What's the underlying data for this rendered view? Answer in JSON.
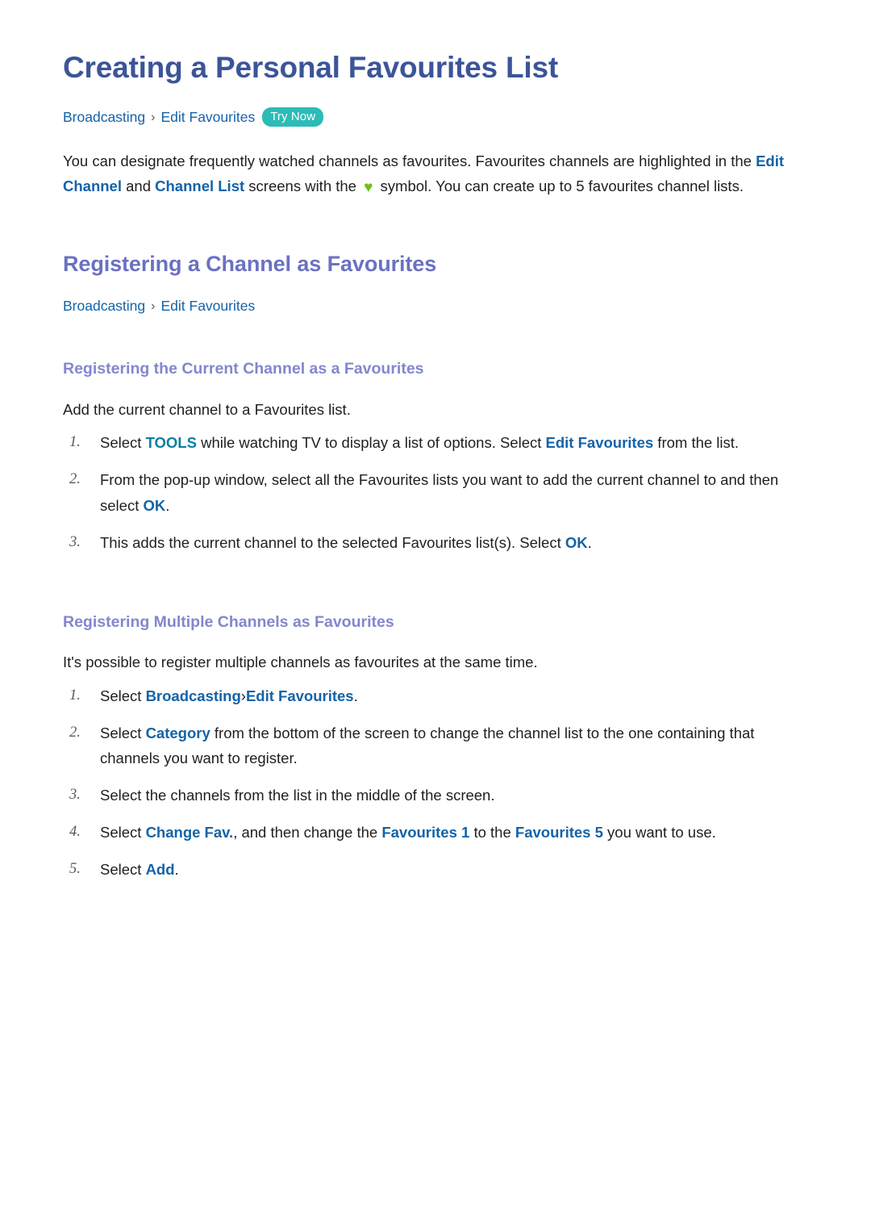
{
  "document": {
    "title": "Creating a Personal Favourites List"
  },
  "breadcrumb_top": {
    "crumb1": "Broadcasting",
    "separator": "›",
    "crumb2": "Edit Favourites",
    "badge": "Try Now"
  },
  "intro": {
    "line1_a": "You can designate frequently watched channels as favourites. Favourites channels are highlighted in the ",
    "link_edit_channel": "Edit Channel",
    "line1_b": " and ",
    "link_channel_list": "Channel List",
    "line1_c": " screens with the ",
    "heart_icon": "♥",
    "line1_d": " symbol. You can create up to 5 favourites channel lists."
  },
  "section_registering": {
    "title": "Registering a Channel as Favourites",
    "breadcrumb": {
      "crumb1": "Broadcasting",
      "separator": "›",
      "crumb2": "Edit Favourites"
    }
  },
  "subsection_current": {
    "title": "Registering the Current Channel as a Favourites",
    "intro": "Add the current channel to a Favourites list.",
    "steps": [
      {
        "a": "Select ",
        "link1": "TOOLS",
        "b": " while watching TV to display a list of options. Select ",
        "link2": "Edit Favourites",
        "c": " from the list."
      },
      {
        "a": "From the pop-up window, select all the Favourites lists you want to add the current channel to and then select ",
        "link1": "OK",
        "b": "."
      },
      {
        "a": "This adds the current channel to the selected Favourites list(s). Select ",
        "link1": "OK",
        "b": "."
      }
    ]
  },
  "subsection_multiple": {
    "title": "Registering Multiple Channels as Favourites",
    "intro": "It's possible to register multiple channels as favourites at the same time.",
    "steps": [
      {
        "a": "Select ",
        "link1": "Broadcasting",
        "sep": "›",
        "link2": "Edit Favourites",
        "b": "."
      },
      {
        "a": "Select ",
        "link1": "Category",
        "b": " from the bottom of the screen to change the channel list to the one containing that channels you want to register."
      },
      {
        "a": "Select the channels from the list in the middle of the screen."
      },
      {
        "a": "Select ",
        "link1": "Change Fav.",
        "b": ", and then change the ",
        "link2": "Favourites 1",
        "c": " to the ",
        "link3": "Favourites 5",
        "d": " you want to use."
      },
      {
        "a": "Select ",
        "link1": "Add",
        "b": "."
      }
    ]
  },
  "colors": {
    "h1": "#3c5499",
    "h2": "#6a71c2",
    "h3": "#8287ce",
    "link": "#1463a8",
    "link_teal": "#0d7fa0",
    "badge_bg": "#2bbcb6",
    "heart": "#6cc211",
    "body": "#1f1f1f"
  }
}
